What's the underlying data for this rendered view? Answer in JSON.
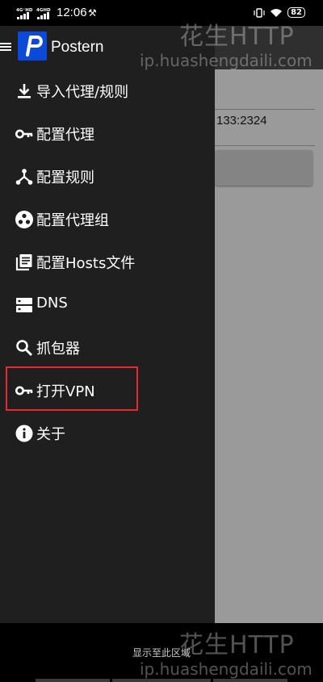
{
  "status_bar": {
    "net1": "4G⁺HD",
    "net2": "4GHD",
    "time": "12:06",
    "battery": "82"
  },
  "background": {
    "address_fragment": "133:2324"
  },
  "drawer": {
    "app_name": "Postern",
    "logo_letter": "P",
    "items": [
      {
        "label": "导入代理/规则",
        "icon": "download-icon"
      },
      {
        "label": "配置代理",
        "icon": "key-icon"
      },
      {
        "label": "配置规则",
        "icon": "tree-icon"
      },
      {
        "label": "配置代理组",
        "icon": "group-icon"
      },
      {
        "label": "配置Hosts文件",
        "icon": "file-list-icon"
      },
      {
        "label": "DNS",
        "icon": "dns-server-icon"
      },
      {
        "label": "抓包器",
        "icon": "search-icon"
      },
      {
        "label": "打开VPN",
        "icon": "key-icon"
      },
      {
        "label": "关于",
        "icon": "info-icon"
      }
    ]
  },
  "highlight_color": "#e8282c",
  "bottom_hint": "显示至此区域",
  "watermark": {
    "brand": "花生HTTP",
    "url": "ip.huashengdaili.com"
  }
}
